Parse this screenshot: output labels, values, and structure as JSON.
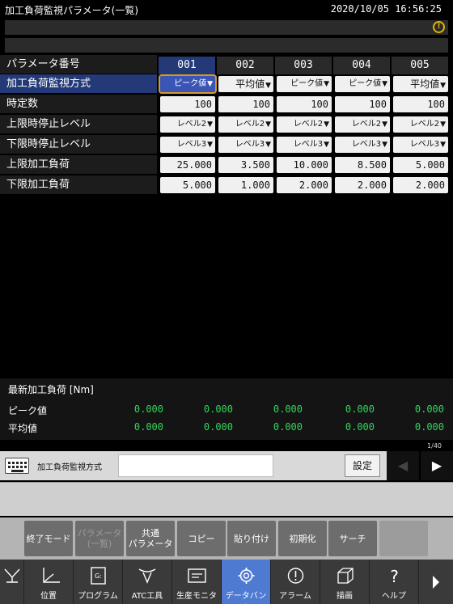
{
  "window": {
    "title": "加工負荷監視パラメータ(一覧)",
    "datetime": "2020/10/05 16:56:25"
  },
  "table": {
    "corner_label": "パラメータ番号",
    "columns": [
      "001",
      "002",
      "003",
      "004",
      "005"
    ],
    "rows": [
      {
        "label": "加工負荷監視方式",
        "values": [
          "ピーク値",
          "平均値",
          "ピーク値",
          "ピーク値",
          "平均値"
        ]
      },
      {
        "label": "時定数",
        "values": [
          "100",
          "100",
          "100",
          "100",
          "100"
        ]
      },
      {
        "label": "上限時停止レベル",
        "values": [
          "レベル2",
          "レベル2",
          "レベル2",
          "レベル2",
          "レベル2"
        ]
      },
      {
        "label": "下限時停止レベル",
        "values": [
          "レベル3",
          "レベル3",
          "レベル3",
          "レベル3",
          "レベル3"
        ]
      },
      {
        "label": "上限加工負荷",
        "values": [
          "25.000",
          "3.500",
          "10.000",
          "8.500",
          "5.000"
        ]
      },
      {
        "label": "下限加工負荷",
        "values": [
          "5.000",
          "1.000",
          "2.000",
          "2.000",
          "2.000"
        ]
      }
    ]
  },
  "latest": {
    "title": "最新加工負荷 [Nm]",
    "rows": [
      {
        "label": "ピーク値",
        "values": [
          "0.000",
          "0.000",
          "0.000",
          "0.000",
          "0.000"
        ]
      },
      {
        "label": "平均値",
        "values": [
          "0.000",
          "0.000",
          "0.000",
          "0.000",
          "0.000"
        ]
      }
    ]
  },
  "input": {
    "page": "1/40",
    "prompt_label": "加工負荷監視方式",
    "set_label": "設定",
    "value": ""
  },
  "softkeys": [
    {
      "label": "終了モード",
      "enabled": true
    },
    {
      "label": "パラメータ\n(一覧)",
      "enabled": false
    },
    {
      "label": "共通\nパラメータ",
      "enabled": true
    },
    {
      "label": "コピー",
      "enabled": true
    },
    {
      "label": "貼り付け",
      "enabled": true
    },
    {
      "label": "初期化",
      "enabled": true
    },
    {
      "label": "サーチ",
      "enabled": true
    },
    {
      "label": "",
      "enabled": true
    }
  ],
  "bottom_nav": [
    {
      "label": "位置",
      "icon": "axes-icon"
    },
    {
      "label": "プログラム",
      "icon": "program-icon"
    },
    {
      "label": "ATC工具",
      "icon": "tool-icon"
    },
    {
      "label": "生産モニタ",
      "icon": "monitor-icon"
    },
    {
      "label": "データバンク",
      "icon": "gear-icon",
      "active": true
    },
    {
      "label": "アラーム",
      "icon": "alarm-icon"
    },
    {
      "label": "描画",
      "icon": "cube-icon"
    },
    {
      "label": "ヘルプ",
      "icon": "help-icon"
    }
  ],
  "colors": {
    "selected_row": "#243a78",
    "active_tab": "#4f7ad2",
    "value_green": "#33d45a",
    "focus_outline": "#d99a1c"
  }
}
